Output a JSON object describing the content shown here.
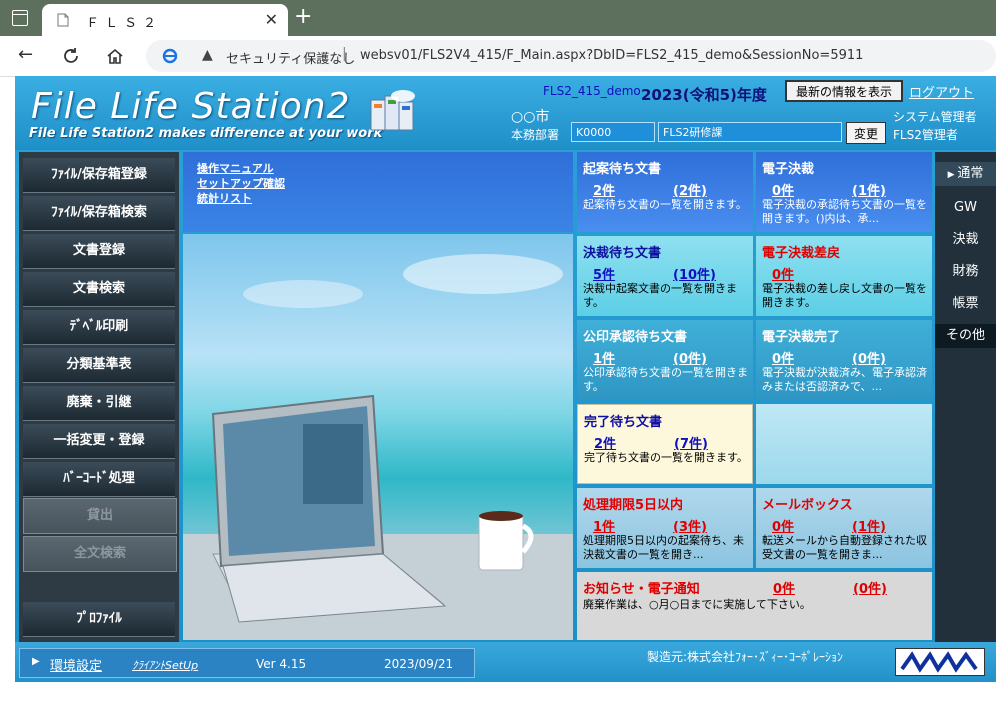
{
  "browser": {
    "tab_title": "ＦＬＳ２",
    "security_label": "セキュリティ保護なし",
    "url": "websv01/FLS2V4_415/F_Main.aspx?DbID=FLS2_415_demo&SessionNo=5911"
  },
  "header": {
    "logo_text": "File Life Station2",
    "tagline": "File Life Station2 makes difference at your work",
    "db_name": "FLS2_415_demo",
    "fiscal_year": "2023(令和5)年度",
    "refresh_button": "最新の情報を表示",
    "logout": "ログアウト",
    "city": "○○市",
    "dept_label": "本務部署",
    "dept_code": "K0000",
    "dept_name": "FLS2研修課",
    "change_button": "変更",
    "role1": "システム管理者",
    "role2": "FLS2管理者"
  },
  "menu": [
    {
      "label": "ﾌｧｲﾙ/保存箱登録",
      "enabled": true
    },
    {
      "label": "ﾌｧｲﾙ/保存箱検索",
      "enabled": true
    },
    {
      "label": "文書登録",
      "enabled": true
    },
    {
      "label": "文書検索",
      "enabled": true
    },
    {
      "label": "ﾃﾞﾍﾞﾙ印刷",
      "enabled": true
    },
    {
      "label": "分類基準表",
      "enabled": true
    },
    {
      "label": "廃棄・引継",
      "enabled": true
    },
    {
      "label": "一括変更・登録",
      "enabled": true
    },
    {
      "label": "ﾊﾞｰｺｰﾄﾞ処理",
      "enabled": true
    },
    {
      "label": "貸出",
      "enabled": false
    },
    {
      "label": "全文検索",
      "enabled": false
    },
    {
      "label": "ﾌﾟﾛﾌｧｲﾙ",
      "enabled": true
    }
  ],
  "top_links": [
    "操作マニュアル",
    "セットアップ確認",
    "統計リスト"
  ],
  "tiles": [
    {
      "title": "起案待ち文書",
      "count1": "2件",
      "count2": "(2件)",
      "desc": "起案待ち文書の一覧を開きます。"
    },
    {
      "title": "電子決裁",
      "count1": "0件",
      "count2": "(1件)",
      "desc": "電子決裁の承認待ち文書の一覧を開きます。()内は、承..."
    },
    {
      "title": "決裁待ち文書",
      "count1": "5件",
      "count2": "(10件)",
      "desc": "決裁中起案文書の一覧を開きます。"
    },
    {
      "title": "電子決裁差戻",
      "count1": "0件",
      "count2": "",
      "desc": "電子決裁の差し戻し文書の一覧を開きます。"
    },
    {
      "title": "公印承認待ち文書",
      "count1": "1件",
      "count2": "(0件)",
      "desc": "公印承認待ち文書の一覧を開きます。"
    },
    {
      "title": "電子決裁完了",
      "count1": "0件",
      "count2": "(0件)",
      "desc": "電子決裁が決裁済み、電子承認済みまたは否認済みで、..."
    },
    {
      "title": "完了待ち文書",
      "count1": "2件",
      "count2": "(7件)",
      "desc": "完了待ち文書の一覧を開きます。"
    },
    {
      "title": "",
      "count1": "",
      "count2": "",
      "desc": ""
    },
    {
      "title": "処理期限5日以内",
      "count1": "1件",
      "count2": "(3件)",
      "desc": "処理期限5日以内の起案待ち、未決裁文書の一覧を開き..."
    },
    {
      "title": "メールボックス",
      "count1": "0件",
      "count2": "(1件)",
      "desc": "転送メールから自動登録された収受文書の一覧を開きま..."
    },
    {
      "title": "お知らせ・電子通知",
      "count1": "0件",
      "count2": "(0件)",
      "desc": "廃棄作業は、○月○日までに実施して下さい。"
    }
  ],
  "sidenav": [
    "通常",
    "GW",
    "決裁",
    "財務",
    "帳票",
    "その他"
  ],
  "footer": {
    "env": "環境設定",
    "client": "ｸﾗｲｱﾝﾄSetUp",
    "version": "Ver 4.15",
    "date": "2023/09/21",
    "maker": "製造元:株式会社ﾌｫｰ･ｽﾞｨｰ･ｺｰﾎﾟﾚｰｼｮﾝ"
  },
  "colors": {
    "tile_blue_title": "#1010a0",
    "tile_red_title": "#e00000",
    "tile_white_title": "#ffffff",
    "accent_blue": "#1e8fd8"
  }
}
